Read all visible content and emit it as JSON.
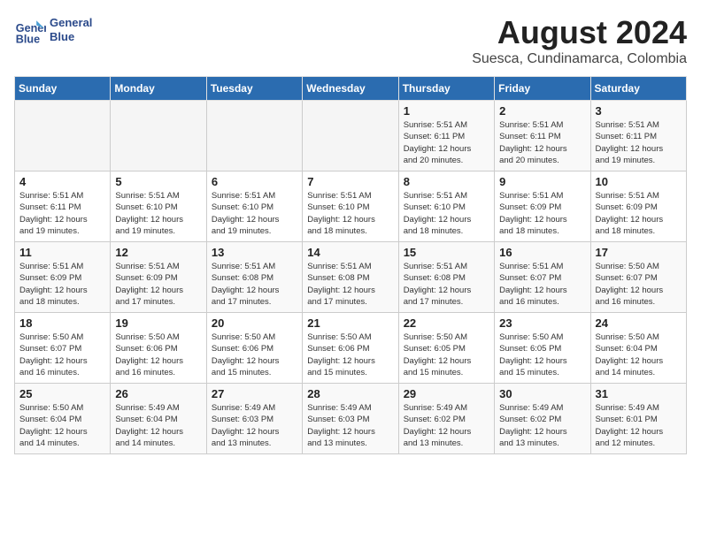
{
  "header": {
    "logo_line1": "General",
    "logo_line2": "Blue",
    "month_year": "August 2024",
    "location": "Suesca, Cundinamarca, Colombia"
  },
  "days_of_week": [
    "Sunday",
    "Monday",
    "Tuesday",
    "Wednesday",
    "Thursday",
    "Friday",
    "Saturday"
  ],
  "weeks": [
    [
      {
        "day": "",
        "info": ""
      },
      {
        "day": "",
        "info": ""
      },
      {
        "day": "",
        "info": ""
      },
      {
        "day": "",
        "info": ""
      },
      {
        "day": "1",
        "info": "Sunrise: 5:51 AM\nSunset: 6:11 PM\nDaylight: 12 hours\nand 20 minutes."
      },
      {
        "day": "2",
        "info": "Sunrise: 5:51 AM\nSunset: 6:11 PM\nDaylight: 12 hours\nand 20 minutes."
      },
      {
        "day": "3",
        "info": "Sunrise: 5:51 AM\nSunset: 6:11 PM\nDaylight: 12 hours\nand 19 minutes."
      }
    ],
    [
      {
        "day": "4",
        "info": "Sunrise: 5:51 AM\nSunset: 6:11 PM\nDaylight: 12 hours\nand 19 minutes."
      },
      {
        "day": "5",
        "info": "Sunrise: 5:51 AM\nSunset: 6:10 PM\nDaylight: 12 hours\nand 19 minutes."
      },
      {
        "day": "6",
        "info": "Sunrise: 5:51 AM\nSunset: 6:10 PM\nDaylight: 12 hours\nand 19 minutes."
      },
      {
        "day": "7",
        "info": "Sunrise: 5:51 AM\nSunset: 6:10 PM\nDaylight: 12 hours\nand 18 minutes."
      },
      {
        "day": "8",
        "info": "Sunrise: 5:51 AM\nSunset: 6:10 PM\nDaylight: 12 hours\nand 18 minutes."
      },
      {
        "day": "9",
        "info": "Sunrise: 5:51 AM\nSunset: 6:09 PM\nDaylight: 12 hours\nand 18 minutes."
      },
      {
        "day": "10",
        "info": "Sunrise: 5:51 AM\nSunset: 6:09 PM\nDaylight: 12 hours\nand 18 minutes."
      }
    ],
    [
      {
        "day": "11",
        "info": "Sunrise: 5:51 AM\nSunset: 6:09 PM\nDaylight: 12 hours\nand 18 minutes."
      },
      {
        "day": "12",
        "info": "Sunrise: 5:51 AM\nSunset: 6:09 PM\nDaylight: 12 hours\nand 17 minutes."
      },
      {
        "day": "13",
        "info": "Sunrise: 5:51 AM\nSunset: 6:08 PM\nDaylight: 12 hours\nand 17 minutes."
      },
      {
        "day": "14",
        "info": "Sunrise: 5:51 AM\nSunset: 6:08 PM\nDaylight: 12 hours\nand 17 minutes."
      },
      {
        "day": "15",
        "info": "Sunrise: 5:51 AM\nSunset: 6:08 PM\nDaylight: 12 hours\nand 17 minutes."
      },
      {
        "day": "16",
        "info": "Sunrise: 5:51 AM\nSunset: 6:07 PM\nDaylight: 12 hours\nand 16 minutes."
      },
      {
        "day": "17",
        "info": "Sunrise: 5:50 AM\nSunset: 6:07 PM\nDaylight: 12 hours\nand 16 minutes."
      }
    ],
    [
      {
        "day": "18",
        "info": "Sunrise: 5:50 AM\nSunset: 6:07 PM\nDaylight: 12 hours\nand 16 minutes."
      },
      {
        "day": "19",
        "info": "Sunrise: 5:50 AM\nSunset: 6:06 PM\nDaylight: 12 hours\nand 16 minutes."
      },
      {
        "day": "20",
        "info": "Sunrise: 5:50 AM\nSunset: 6:06 PM\nDaylight: 12 hours\nand 15 minutes."
      },
      {
        "day": "21",
        "info": "Sunrise: 5:50 AM\nSunset: 6:06 PM\nDaylight: 12 hours\nand 15 minutes."
      },
      {
        "day": "22",
        "info": "Sunrise: 5:50 AM\nSunset: 6:05 PM\nDaylight: 12 hours\nand 15 minutes."
      },
      {
        "day": "23",
        "info": "Sunrise: 5:50 AM\nSunset: 6:05 PM\nDaylight: 12 hours\nand 15 minutes."
      },
      {
        "day": "24",
        "info": "Sunrise: 5:50 AM\nSunset: 6:04 PM\nDaylight: 12 hours\nand 14 minutes."
      }
    ],
    [
      {
        "day": "25",
        "info": "Sunrise: 5:50 AM\nSunset: 6:04 PM\nDaylight: 12 hours\nand 14 minutes."
      },
      {
        "day": "26",
        "info": "Sunrise: 5:49 AM\nSunset: 6:04 PM\nDaylight: 12 hours\nand 14 minutes."
      },
      {
        "day": "27",
        "info": "Sunrise: 5:49 AM\nSunset: 6:03 PM\nDaylight: 12 hours\nand 13 minutes."
      },
      {
        "day": "28",
        "info": "Sunrise: 5:49 AM\nSunset: 6:03 PM\nDaylight: 12 hours\nand 13 minutes."
      },
      {
        "day": "29",
        "info": "Sunrise: 5:49 AM\nSunset: 6:02 PM\nDaylight: 12 hours\nand 13 minutes."
      },
      {
        "day": "30",
        "info": "Sunrise: 5:49 AM\nSunset: 6:02 PM\nDaylight: 12 hours\nand 13 minutes."
      },
      {
        "day": "31",
        "info": "Sunrise: 5:49 AM\nSunset: 6:01 PM\nDaylight: 12 hours\nand 12 minutes."
      }
    ]
  ]
}
